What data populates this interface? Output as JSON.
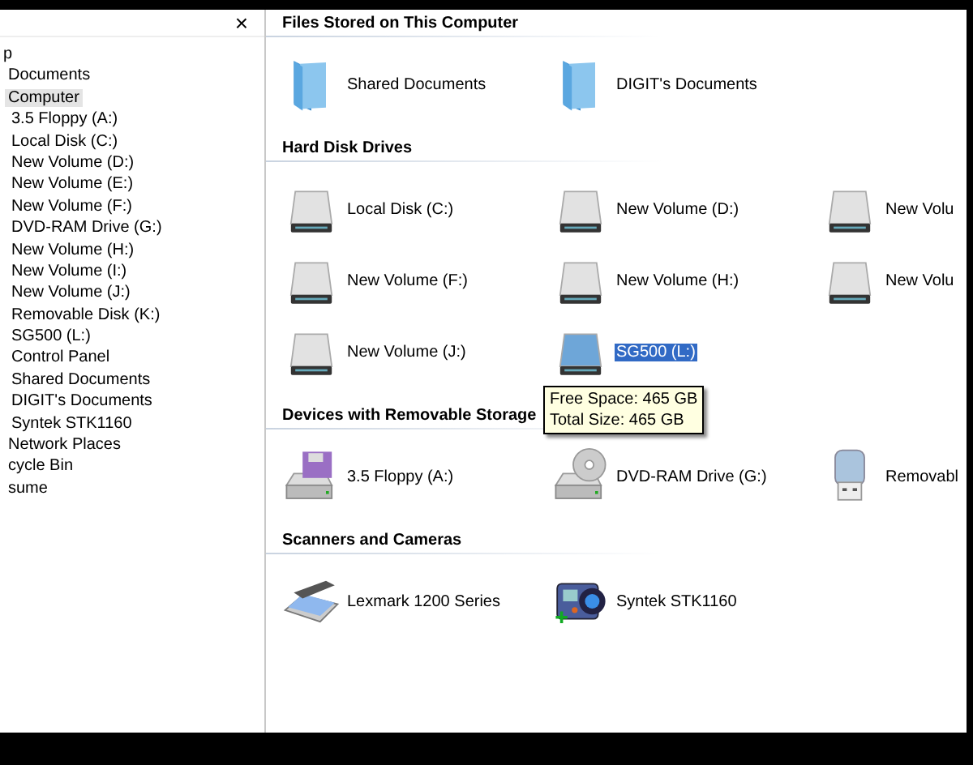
{
  "folders_pane": {
    "close_button": "×",
    "tree": [
      {
        "label": "p",
        "selected": false,
        "children": [
          {
            "label": "Documents",
            "selected": false
          },
          {
            "label": "Computer",
            "selected": true,
            "children": [
              {
                "label": "3.5 Floppy (A:)",
                "selected": false
              },
              {
                "label": "Local Disk (C:)",
                "selected": false
              },
              {
                "label": "New Volume (D:)",
                "selected": false
              },
              {
                "label": "New Volume (E:)",
                "selected": false
              },
              {
                "label": "New Volume (F:)",
                "selected": false
              },
              {
                "label": "DVD-RAM Drive (G:)",
                "selected": false
              },
              {
                "label": "New Volume (H:)",
                "selected": false
              },
              {
                "label": "New Volume (I:)",
                "selected": false
              },
              {
                "label": "New Volume (J:)",
                "selected": false
              },
              {
                "label": "Removable Disk (K:)",
                "selected": false
              },
              {
                "label": "SG500 (L:)",
                "selected": false
              },
              {
                "label": "Control Panel",
                "selected": false
              },
              {
                "label": "Shared Documents",
                "selected": false
              },
              {
                "label": "DIGIT's Documents",
                "selected": false
              },
              {
                "label": "Syntek STK1160",
                "selected": false
              }
            ]
          },
          {
            "label": "Network Places",
            "selected": false
          },
          {
            "label": "cycle Bin",
            "selected": false
          },
          {
            "label": "sume",
            "selected": false
          }
        ]
      }
    ]
  },
  "sections": [
    {
      "title": "Files Stored on This Computer",
      "items": [
        {
          "label": "Shared Documents",
          "kind": "folder",
          "selected": false
        },
        {
          "label": "DIGIT's Documents",
          "kind": "folder",
          "selected": false
        }
      ]
    },
    {
      "title": "Hard Disk Drives",
      "items": [
        {
          "label": "Local Disk (C:)",
          "kind": "drive",
          "selected": false
        },
        {
          "label": "New Volume (D:)",
          "kind": "drive",
          "selected": false
        },
        {
          "label": "New Volu",
          "kind": "drive",
          "selected": false
        },
        {
          "label": "New Volume (F:)",
          "kind": "drive",
          "selected": false
        },
        {
          "label": "New Volume (H:)",
          "kind": "drive",
          "selected": false
        },
        {
          "label": "New Volu",
          "kind": "drive",
          "selected": false
        },
        {
          "label": "New Volume (J:)",
          "kind": "drive",
          "selected": false
        },
        {
          "label": "SG500 (L:)",
          "kind": "drive",
          "selected": true,
          "tooltip": [
            "Free Space: 465 GB",
            "Total Size: 465 GB"
          ]
        }
      ]
    },
    {
      "title": "Devices with Removable Storage",
      "items": [
        {
          "label": "3.5 Floppy (A:)",
          "kind": "floppy",
          "selected": false
        },
        {
          "label": "DVD-RAM Drive (G:)",
          "kind": "dvd",
          "selected": false
        },
        {
          "label": "Removabl",
          "kind": "usb",
          "selected": false
        }
      ]
    },
    {
      "title": "Scanners and Cameras",
      "items": [
        {
          "label": "Lexmark 1200 Series",
          "kind": "scanner",
          "selected": false
        },
        {
          "label": "Syntek STK1160",
          "kind": "camera",
          "selected": false
        }
      ]
    }
  ]
}
